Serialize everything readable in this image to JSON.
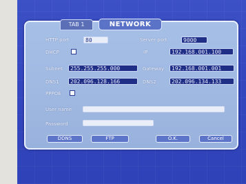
{
  "dialog": {
    "title": "NETWORK",
    "tab_label": "TAB 1"
  },
  "fields": {
    "http_port": {
      "label": "HTTP port",
      "value": "80"
    },
    "server_port": {
      "label": "Server port",
      "value": "9000"
    },
    "dhcp": {
      "label": "DHCP",
      "checked": false
    },
    "ip": {
      "label": "IP",
      "value": "192.168.001.100"
    },
    "subnet": {
      "label": "Subnet",
      "value": "255.255.255.000"
    },
    "gateway": {
      "label": "Gateway",
      "value": "192.168.001.001"
    },
    "dns1": {
      "label": "DNS1",
      "value": "202.096.128.166"
    },
    "dns2": {
      "label": "DNS2",
      "value": "202.096.134.133"
    },
    "pppoe": {
      "label": "PPPOE",
      "checked": false
    },
    "user_name": {
      "label": "User name",
      "value": ""
    },
    "password": {
      "label": "Password",
      "value": ""
    }
  },
  "buttons": {
    "ddns": "DDNS",
    "ftp": "FTP",
    "ok": "O.K.",
    "cancel": "Cancel"
  },
  "colors": {
    "screen_bg": "#3447bf",
    "dialog_bg": "#a6bfe6",
    "field_dark": "#1f2f86",
    "field_light": "#e9eef9"
  }
}
